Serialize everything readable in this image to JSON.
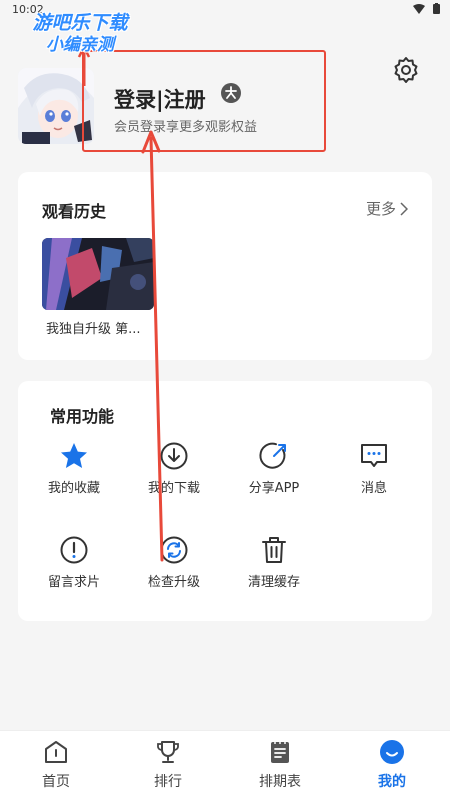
{
  "status_bar": {
    "time": "10:02"
  },
  "watermark": {
    "line1": "游吧乐下载",
    "line2": "小编亲测"
  },
  "profile": {
    "login_label": "登录|注册",
    "subtitle": "会员登录享更多观影权益"
  },
  "history": {
    "title": "观看历史",
    "more_label": "更多",
    "items": [
      {
        "title": "我独自升级 第..."
      }
    ]
  },
  "functions": {
    "title": "常用功能",
    "items": [
      {
        "label": "我的收藏",
        "icon": "star-icon"
      },
      {
        "label": "我的下载",
        "icon": "download-icon"
      },
      {
        "label": "分享APP",
        "icon": "share-icon"
      },
      {
        "label": "消息",
        "icon": "message-icon"
      },
      {
        "label": "留言求片",
        "icon": "exclamation-icon"
      },
      {
        "label": "检查升级",
        "icon": "refresh-icon"
      },
      {
        "label": "清理缓存",
        "icon": "trash-icon"
      }
    ]
  },
  "tabs": [
    {
      "label": "首页",
      "icon": "home-icon"
    },
    {
      "label": "排行",
      "icon": "trophy-icon"
    },
    {
      "label": "排期表",
      "icon": "schedule-icon"
    },
    {
      "label": "我的",
      "icon": "profile-icon",
      "active": true
    }
  ],
  "colors": {
    "accent": "#1a73e8",
    "annotation": "#e8493a",
    "background": "#f5f5f5"
  }
}
